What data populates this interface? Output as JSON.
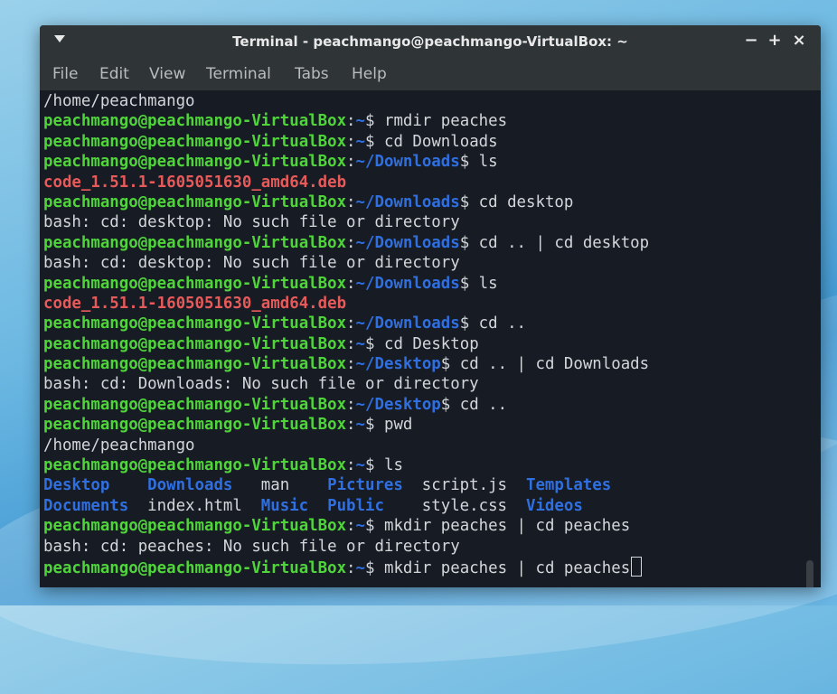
{
  "window": {
    "title": "Terminal - peachmango@peachmango-VirtualBox: ~",
    "minimize_label": "−",
    "maximize_label": "+",
    "close_label": "×"
  },
  "menubar": {
    "items": [
      "File",
      "Edit",
      "View",
      "Terminal",
      "Tabs",
      "Help"
    ]
  },
  "prompt_user": "peachmango@peachmango-VirtualBox",
  "lines": [
    {
      "type": "output",
      "text": "/home/peachmango"
    },
    {
      "type": "prompt",
      "path": "~",
      "cmd": " rmdir peaches"
    },
    {
      "type": "prompt",
      "path": "~",
      "cmd": " cd Downloads"
    },
    {
      "type": "prompt",
      "path": "~/Downloads",
      "cmd": " ls"
    },
    {
      "type": "deb",
      "text": "code_1.51.1-1605051630_amd64.deb"
    },
    {
      "type": "prompt",
      "path": "~/Downloads",
      "cmd": " cd desktop"
    },
    {
      "type": "output",
      "text": "bash: cd: desktop: No such file or directory"
    },
    {
      "type": "prompt",
      "path": "~/Downloads",
      "cmd": " cd .. | cd desktop"
    },
    {
      "type": "output",
      "text": "bash: cd: desktop: No such file or directory"
    },
    {
      "type": "prompt",
      "path": "~/Downloads",
      "cmd": " ls"
    },
    {
      "type": "deb",
      "text": "code_1.51.1-1605051630_amd64.deb"
    },
    {
      "type": "prompt",
      "path": "~/Downloads",
      "cmd": " cd .."
    },
    {
      "type": "prompt",
      "path": "~",
      "cmd": " cd Desktop"
    },
    {
      "type": "prompt",
      "path": "~/Desktop",
      "cmd": " cd .. | cd Downloads"
    },
    {
      "type": "output",
      "text": "bash: cd: Downloads: No such file or directory"
    },
    {
      "type": "prompt",
      "path": "~/Desktop",
      "cmd": " cd .."
    },
    {
      "type": "prompt",
      "path": "~",
      "cmd": " pwd"
    },
    {
      "type": "output",
      "text": "/home/peachmango"
    },
    {
      "type": "prompt",
      "path": "~",
      "cmd": " ls"
    },
    {
      "type": "ls",
      "entries": [
        {
          "name": "Desktop",
          "kind": "dir"
        },
        {
          "name": "Downloads",
          "kind": "dir"
        },
        {
          "name": "man",
          "kind": "file"
        },
        {
          "name": "Pictures",
          "kind": "dir"
        },
        {
          "name": "script.js",
          "kind": "file"
        },
        {
          "name": "Templates",
          "kind": "dir"
        }
      ]
    },
    {
      "type": "ls",
      "entries": [
        {
          "name": "Documents",
          "kind": "dir"
        },
        {
          "name": "index.html",
          "kind": "file"
        },
        {
          "name": "Music",
          "kind": "dir"
        },
        {
          "name": "Public",
          "kind": "dir"
        },
        {
          "name": "style.css",
          "kind": "file"
        },
        {
          "name": "Videos",
          "kind": "dir"
        }
      ]
    },
    {
      "type": "prompt",
      "path": "~",
      "cmd": " mkdir peaches | cd peaches"
    },
    {
      "type": "output",
      "text": "bash: cd: peaches: No such file or directory"
    },
    {
      "type": "prompt",
      "path": "~",
      "cmd": " mkdir peaches | cd peaches",
      "cursor": true
    }
  ],
  "colors": {
    "prompt_user": "#4fd53a",
    "prompt_path": "#2f6fe0",
    "deb_file": "#e65a5a",
    "directory": "#2f6fe0",
    "text": "#d4d7da",
    "terminal_bg": "#171b24",
    "titlebar_bg": "#2f3437"
  },
  "icons": {
    "window_menu": "chevron-down-icon",
    "minimize": "minimize-icon",
    "maximize": "maximize-icon",
    "close": "close-icon"
  }
}
